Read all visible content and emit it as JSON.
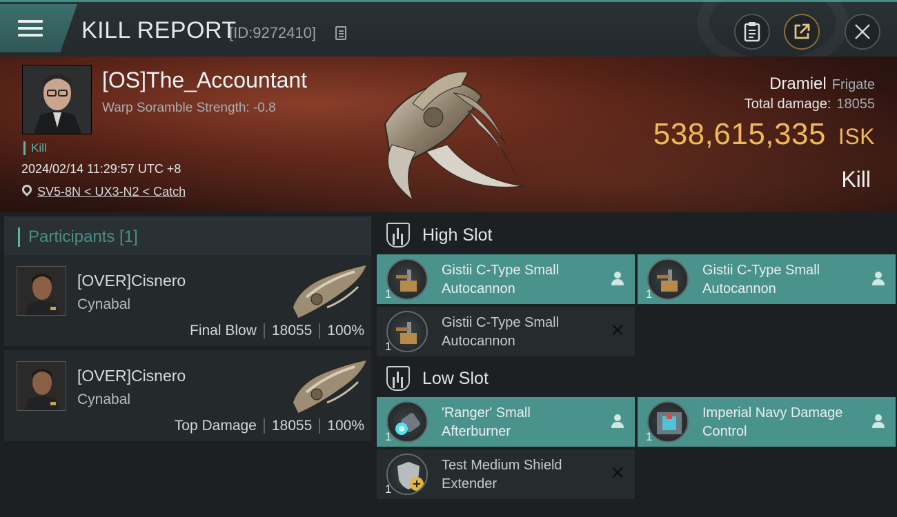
{
  "header": {
    "title": "KILL REPORT",
    "report_id": "[ID:9272410]",
    "icons": [
      "menu-icon",
      "copy-icon",
      "clipboard-icon",
      "share-icon",
      "close-icon"
    ]
  },
  "victim": {
    "name": "[OS]The_Accountant",
    "warp_scramble": "Warp Soramble Strength: -0.8",
    "tag": "Kill",
    "timestamp": "2024/02/14 11:29:57 UTC +8",
    "location": "SV5-8N < UX3-N2 < Catch",
    "ship_name": "Dramiel",
    "ship_class": "Frigate",
    "total_damage_label": "Total damage:",
    "total_damage_value": "18055",
    "isk_value": "538,615,335",
    "isk_unit": "ISK",
    "result": "Kill"
  },
  "participants": {
    "header_label": "Participants [1]",
    "rows": [
      {
        "name": "[OVER]Cisnero",
        "ship": "Cynabal",
        "role": "Final Blow",
        "damage": "18055",
        "percent": "100%"
      },
      {
        "name": "[OVER]Cisnero",
        "ship": "Cynabal",
        "role": "Top Damage",
        "damage": "18055",
        "percent": "100%"
      }
    ]
  },
  "fittings": {
    "high_slot_label": "High Slot",
    "low_slot_label": "Low Slot",
    "high": [
      {
        "name": "Gistii C-Type Small Autocannon",
        "qty": "1",
        "state": "dropped"
      },
      {
        "name": "Gistii C-Type Small Autocannon",
        "qty": "1",
        "state": "dropped"
      },
      {
        "name": "Gistii C-Type Small Autocannon",
        "qty": "1",
        "state": "destroyed"
      }
    ],
    "low": [
      {
        "name": "'Ranger' Small Afterburner",
        "qty": "1",
        "state": "dropped"
      },
      {
        "name": "Imperial Navy Damage Control",
        "qty": "1",
        "state": "dropped"
      },
      {
        "name": "Test Medium Shield Extender",
        "qty": "1",
        "state": "destroyed"
      }
    ]
  },
  "colors": {
    "accent_teal": "#4a938c",
    "isk_gold": "#f0b95a",
    "banner_red": "#5a2418"
  }
}
